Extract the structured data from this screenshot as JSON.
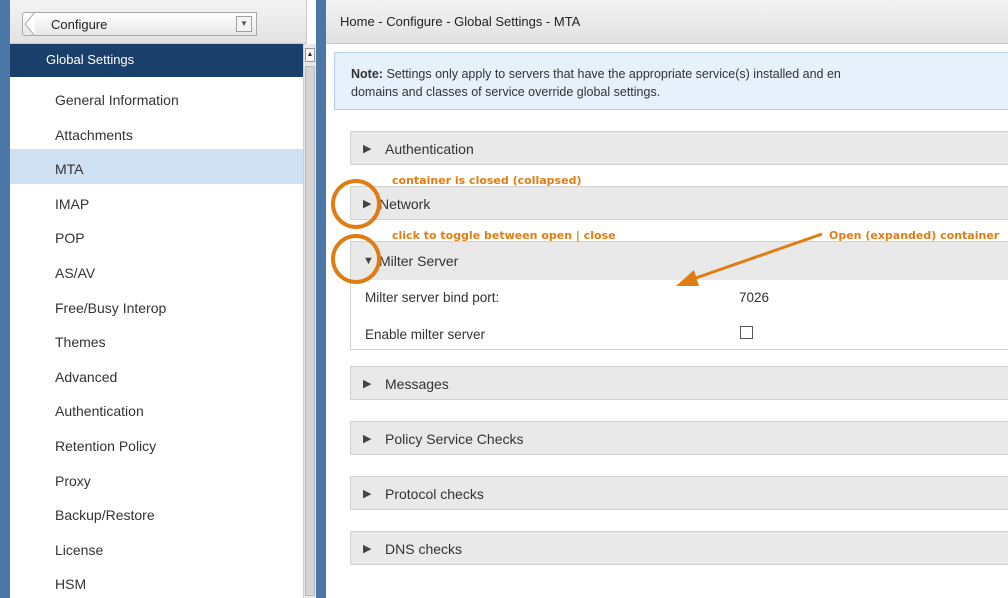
{
  "sidebar": {
    "configure_label": "Configure",
    "header": "Global Settings",
    "items": [
      {
        "label": "General Information",
        "active": false
      },
      {
        "label": "Attachments",
        "active": false
      },
      {
        "label": "MTA",
        "active": true
      },
      {
        "label": "IMAP",
        "active": false
      },
      {
        "label": "POP",
        "active": false
      },
      {
        "label": "AS/AV",
        "active": false
      },
      {
        "label": "Free/Busy Interop",
        "active": false
      },
      {
        "label": "Themes",
        "active": false
      },
      {
        "label": "Advanced",
        "active": false
      },
      {
        "label": "Authentication",
        "active": false
      },
      {
        "label": "Retention Policy",
        "active": false
      },
      {
        "label": "Proxy",
        "active": false
      },
      {
        "label": "Backup/Restore",
        "active": false
      },
      {
        "label": "License",
        "active": false
      },
      {
        "label": "HSM",
        "active": false
      }
    ]
  },
  "main": {
    "breadcrumb": "Home - Configure - Global Settings - MTA",
    "note_label": "Note:",
    "note_line1": "Settings only apply to servers that have the appropriate service(s) installed and en",
    "note_line2": "domains and classes of service override global settings.",
    "sections": {
      "authentication": "Authentication",
      "network": "Network",
      "milter_server": "Milter Server",
      "messages": "Messages",
      "policy_service_checks": "Policy Service Checks",
      "protocol_checks": "Protocol checks",
      "dns_checks": "DNS checks"
    },
    "milter": {
      "bind_port_label": "Milter server bind port:",
      "bind_port_value": "7026",
      "enable_label": "Enable milter server",
      "enable_checked": false
    }
  },
  "annotations": {
    "closed": "container is closed (collapsed)",
    "toggle": "click to toggle between open | close",
    "open": "Open (expanded) container",
    "color": "#e07d12"
  },
  "colors": {
    "frame": "#4a77a8",
    "nav_header": "#193f6a",
    "nav_active": "#cfe0f2",
    "note_bg": "#e6f1fb",
    "section_bg": "#e9e9e9"
  }
}
